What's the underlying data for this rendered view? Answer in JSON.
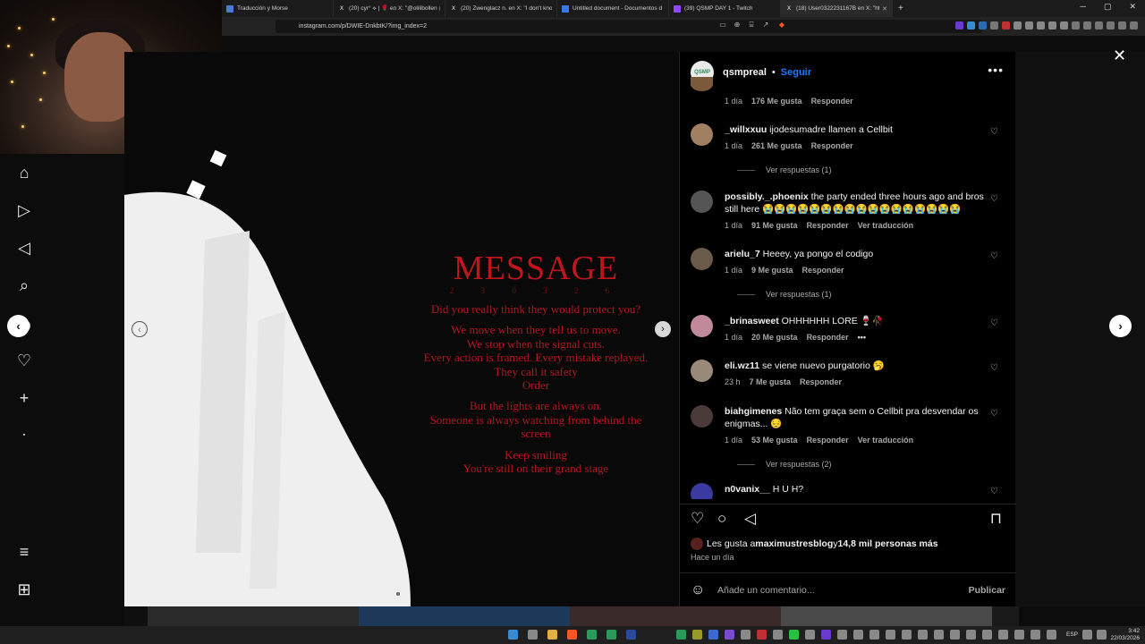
{
  "browser": {
    "tabs": [
      {
        "title": "Traducción y Morse",
        "icon": "document-icon",
        "color": "#4a7bd6"
      },
      {
        "title": "(20) cyr° ⟡ | 🌹 en X: \"@olilibollen @",
        "icon": "x-icon",
        "color": "#111111"
      },
      {
        "title": "(20) Zwenglacz n. en X: \"I don't know",
        "icon": "x-icon",
        "color": "#111111"
      },
      {
        "title": "Untitled document - Documentos d",
        "icon": "docs-icon",
        "color": "#3b78e7"
      },
      {
        "title": "(39) QSMP DAY 1 - Twitch",
        "icon": "twitch-icon",
        "color": "#9146ff"
      },
      {
        "title": "(18) User0322231167B en X: \"https:/",
        "icon": "x-icon",
        "color": "#111111"
      }
    ],
    "url": "instagram.com/p/DWIE-DnkbtK/?img_index=2"
  },
  "post": {
    "title": "MESSAGE",
    "date": "2 3 0 3 2 6",
    "lines": [
      "Did you really think they would protect you?",
      "",
      "We move when they tell us to move.",
      "We stop when the signal cuts.",
      "Every action is framed. Every mistake replayed.",
      "They call it safety",
      "Order",
      "",
      "But the lights are always on.",
      "Someone is always watching from behind the",
      "screen",
      "",
      "Keep smiling",
      "You're still on their grand stage"
    ]
  },
  "panel": {
    "avatar_text": "QSMP",
    "username": "qsmpreal",
    "separator": "•",
    "follow": "Seguir",
    "more": "•••",
    "comments": [
      {
        "user": "",
        "text": "",
        "time": "1 día",
        "likes": "176 Me gusta",
        "reply": "Responder",
        "extra": "",
        "avatar": "#7a5a3a",
        "replies": ""
      },
      {
        "user": "_willxxuu",
        "text": " ijodesumadre llamen a Cellbit",
        "time": "1 día",
        "likes": "261 Me gusta",
        "reply": "Responder",
        "extra": "",
        "avatar": "#a08060",
        "replies": "Ver respuestas (1)"
      },
      {
        "user": "possibly._.phoenix",
        "text": " the party ended three hours ago and bros still here 😭😭😭😭😭😭😭😭😭😭😭😭😭😭😭😭😭",
        "time": "1 día",
        "likes": "91 Me gusta",
        "reply": "Responder",
        "extra": "Ver traducción",
        "avatar": "#555555",
        "replies": ""
      },
      {
        "user": "arielu_7",
        "text": " Heeey, ya pongo el codigo",
        "time": "1 día",
        "likes": "9 Me gusta",
        "reply": "Responder",
        "extra": "",
        "avatar": "#6a5a4a",
        "replies": "Ver respuestas (1)"
      },
      {
        "user": "_brinasweet",
        "text": " OHHHHHH LORE 🍷🥀",
        "time": "1 día",
        "likes": "20 Me gusta",
        "reply": "Responder",
        "extra": "•••",
        "avatar": "#c08a9a",
        "replies": ""
      },
      {
        "user": "eli.wz11",
        "text": " se viene nuevo purgatorio 🥱",
        "time": "23 h",
        "likes": "7 Me gusta",
        "reply": "Responder",
        "extra": "",
        "avatar": "#9a8a7a",
        "replies": ""
      },
      {
        "user": "biahgimenes",
        "text": " Não tem graça sem o Cellbit pra desvendar os enigmas... 😔",
        "time": "1 día",
        "likes": "53 Me gusta",
        "reply": "Responder",
        "extra": "Ver traducción",
        "avatar": "#4a3a3a",
        "replies": "Ver respuestas (2)"
      },
      {
        "user": "n0vanix__",
        "text": " H U H?",
        "time": "",
        "likes": "",
        "reply": "",
        "extra": "",
        "avatar": "#3a3aa0",
        "replies": ""
      }
    ],
    "likes_prefix": "Les gusta a ",
    "likes_user": "maximustresblog",
    "likes_mid": " y ",
    "likes_count": "14,8 mil personas más",
    "when": "Hace un día",
    "comment_placeholder": "Añade un comentario...",
    "publish": "Publicar"
  },
  "taskbar": {
    "lang": "ESP",
    "time": "3:42",
    "date": "22/03/2026"
  }
}
